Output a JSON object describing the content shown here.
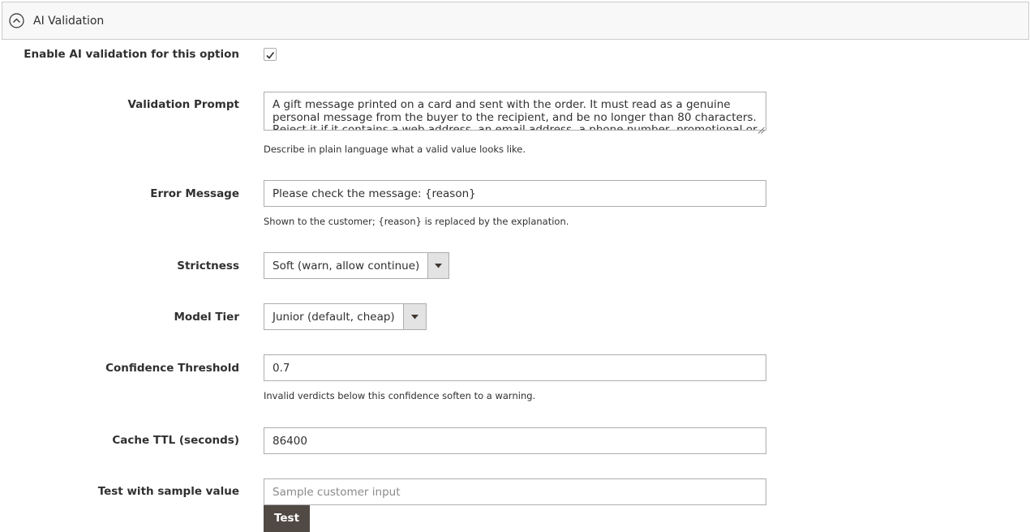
{
  "section": {
    "title": "AI Validation"
  },
  "fields": {
    "enable": {
      "label": "Enable AI validation for this option",
      "checked": true
    },
    "prompt": {
      "label": "Validation Prompt",
      "value": "A gift message printed on a card and sent with the order. It must read as a genuine personal message from the buyer to the recipient, and be no longer than 80 characters. Reject it if it contains a web address, an email address, a phone number, promotional or",
      "note": "Describe in plain language what a valid value looks like."
    },
    "error_message": {
      "label": "Error Message",
      "value": "Please check the message: {reason}",
      "note": "Shown to the customer; {reason} is replaced by the explanation."
    },
    "strictness": {
      "label": "Strictness",
      "selected": "Soft (warn, allow continue)"
    },
    "model_tier": {
      "label": "Model Tier",
      "selected": "Junior (default, cheap)"
    },
    "confidence": {
      "label": "Confidence Threshold",
      "value": "0.7",
      "note": "Invalid verdicts below this confidence soften to a warning."
    },
    "cache_ttl": {
      "label": "Cache TTL (seconds)",
      "value": "86400"
    },
    "test": {
      "label": "Test with sample value",
      "placeholder": "Sample customer input",
      "button_label": "Test"
    }
  }
}
